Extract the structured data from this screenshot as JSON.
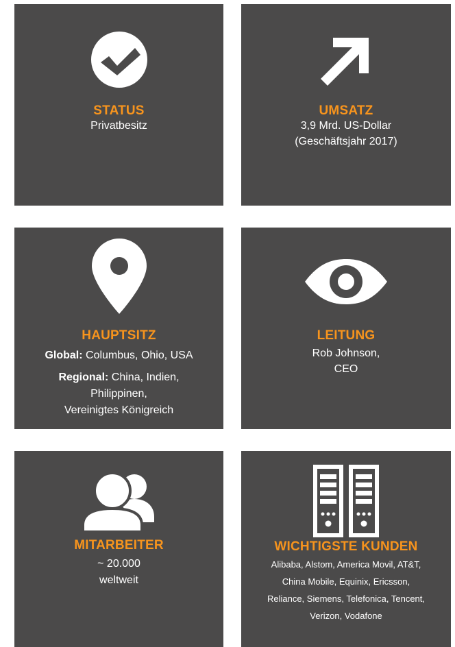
{
  "colors": {
    "card_bg": "#4b4a4a",
    "accent": "#f7941d",
    "text": "#ffffff"
  },
  "status": {
    "heading": "STATUS",
    "value": "Privatbesitz",
    "icon": "check-circle-icon"
  },
  "umsatz": {
    "heading": "UMSATZ",
    "line1": "3,9 Mrd. US-Dollar",
    "line2": "(Geschäftsjahr 2017)",
    "icon": "arrow-up-right-icon"
  },
  "hauptsitz": {
    "heading": "HAUPTSITZ",
    "global_label": "Global:",
    "global_value": " Columbus, Ohio, USA",
    "regional_label": "Regional:",
    "regional_value1": " China, Indien,",
    "regional_value2": "Philippinen,",
    "regional_value3": "Vereinigtes Königreich",
    "icon": "map-pin-icon"
  },
  "leitung": {
    "heading": "LEITUNG",
    "line1": "Rob Johnson,",
    "line2": "CEO",
    "icon": "eye-icon"
  },
  "mitarbeiter": {
    "heading": "MITARBEITER",
    "line1": "~ 20.000",
    "line2": "weltweit",
    "icon": "people-icon"
  },
  "kunden": {
    "heading": "WICHTIGSTE KUNDEN",
    "line1": "Alibaba, Alstom, America Movil, AT&T,",
    "line2": "China Mobile, Equinix, Ericsson,",
    "line3": "Reliance, Siemens, Telefonica, Tencent,",
    "line4": "Verizon, Vodafone",
    "icon": "server-icon"
  }
}
